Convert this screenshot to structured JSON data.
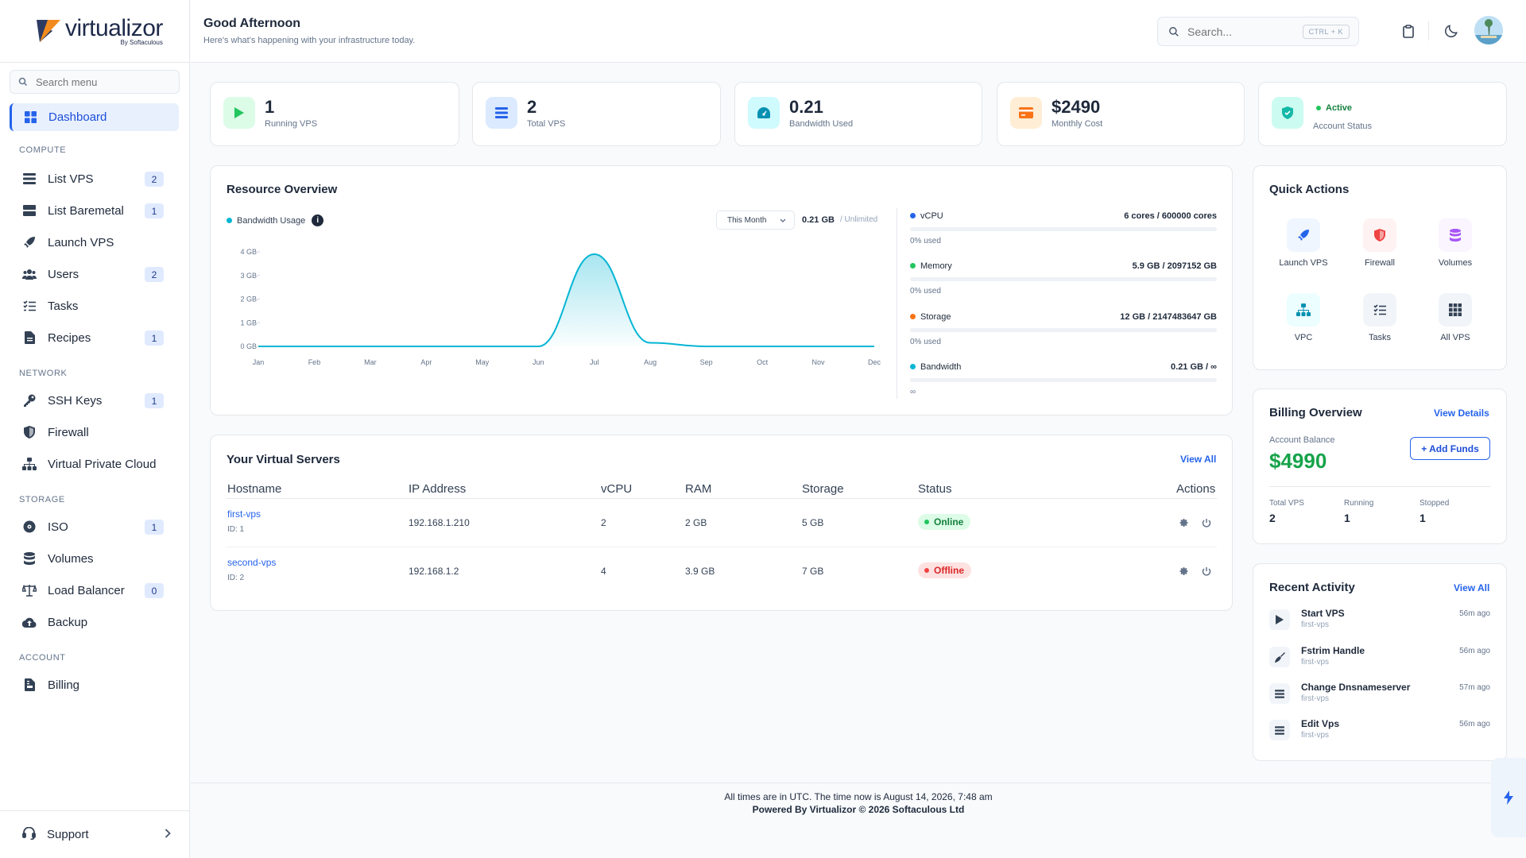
{
  "brand": {
    "name": "virtualizor",
    "sub": "By Softaculous"
  },
  "sidebar": {
    "search_placeholder": "Search menu",
    "dashboard_label": "Dashboard",
    "sections": {
      "compute": "COMPUTE",
      "network": "NETWORK",
      "storage": "STORAGE",
      "account": "ACCOUNT"
    },
    "items": [
      {
        "label": "List VPS",
        "icon": "server-icon",
        "count": "2"
      },
      {
        "label": "List Baremetal",
        "icon": "baremetal-icon",
        "count": "1"
      },
      {
        "label": "Launch VPS",
        "icon": "rocket-icon",
        "count": ""
      },
      {
        "label": "Users",
        "icon": "users-icon",
        "count": "2"
      },
      {
        "label": "Tasks",
        "icon": "tasks-icon",
        "count": ""
      },
      {
        "label": "Recipes",
        "icon": "recipe-icon",
        "count": "1"
      },
      {
        "label": "SSH Keys",
        "icon": "key-icon",
        "count": "1"
      },
      {
        "label": "Firewall",
        "icon": "shield-icon",
        "count": ""
      },
      {
        "label": "Virtual Private Cloud",
        "icon": "network-icon",
        "count": ""
      },
      {
        "label": "ISO",
        "icon": "disc-icon",
        "count": "1"
      },
      {
        "label": "Volumes",
        "icon": "database-icon",
        "count": ""
      },
      {
        "label": "Load Balancer",
        "icon": "balance-icon",
        "count": "0"
      },
      {
        "label": "Backup",
        "icon": "cloud-upload-icon",
        "count": ""
      },
      {
        "label": "Billing",
        "icon": "invoice-icon",
        "count": ""
      }
    ],
    "support_label": "Support"
  },
  "header": {
    "greeting": "Good Afternoon",
    "subtitle": "Here's what's happening with your infrastructure today.",
    "search_placeholder": "Search...",
    "shortcut": "CTRL + K"
  },
  "stats": [
    {
      "value": "1",
      "label": "Running VPS",
      "color": "#22c55e"
    },
    {
      "value": "2",
      "label": "Total VPS",
      "color": "#2563eb"
    },
    {
      "value": "0.21",
      "label": "Bandwidth Used",
      "color": "#0891b2"
    },
    {
      "value": "$2490",
      "label": "Monthly Cost",
      "color": "#f97316"
    },
    {
      "value": "Active",
      "label": "Account Status",
      "color": "#14b8a6"
    }
  ],
  "resource": {
    "title": "Resource Overview",
    "legend": "Bandwidth Usage",
    "period": "This Month",
    "used": "0.21 GB",
    "limit": "/ Unlimited",
    "rows": [
      {
        "name": "vCPU",
        "value": "6 cores / 600000 cores",
        "pct": "0% used",
        "color": "#2563eb"
      },
      {
        "name": "Memory",
        "value": "5.9 GB / 2097152 GB",
        "pct": "0% used",
        "color": "#22c55e"
      },
      {
        "name": "Storage",
        "value": "12 GB / 2147483647 GB",
        "pct": "0% used",
        "color": "#f97316"
      },
      {
        "name": "Bandwidth",
        "value": "0.21 GB / ∞",
        "pct": "∞",
        "color": "#06b6d4"
      }
    ]
  },
  "chart_data": {
    "type": "area",
    "title": "",
    "xlabel": "",
    "ylabel": "",
    "categories": [
      "Jan",
      "Feb",
      "Mar",
      "Apr",
      "May",
      "Jun",
      "Jul",
      "Aug",
      "Sep",
      "Oct",
      "Nov",
      "Dec"
    ],
    "series": [
      {
        "name": "Bandwidth Usage",
        "values": [
          0,
          0,
          0,
          0,
          0,
          0,
          3.9,
          0.15,
          0,
          0,
          0,
          0
        ]
      }
    ],
    "yticks": [
      "0 GB",
      "1 GB",
      "2 GB",
      "3 GB",
      "4 GB"
    ],
    "ylim": [
      0,
      4
    ],
    "color": "#06b6d4",
    "grid": false
  },
  "servers": {
    "title": "Your Virtual Servers",
    "view_all": "View All",
    "columns": [
      "Hostname",
      "IP Address",
      "vCPU",
      "RAM",
      "Storage",
      "Status",
      "Actions"
    ],
    "rows": [
      {
        "host": "first-vps",
        "id": "ID: 1",
        "ip": "192.168.1.210",
        "vcpu": "2",
        "ram": "2 GB",
        "storage": "5 GB",
        "status": "Online"
      },
      {
        "host": "second-vps",
        "id": "ID: 2",
        "ip": "192.168.1.2",
        "vcpu": "4",
        "ram": "3.9 GB",
        "storage": "7 GB",
        "status": "Offline"
      }
    ]
  },
  "quick_actions": {
    "title": "Quick Actions",
    "items": [
      {
        "label": "Launch VPS",
        "icon": "rocket-icon"
      },
      {
        "label": "Firewall",
        "icon": "shield-icon"
      },
      {
        "label": "Volumes",
        "icon": "database-icon"
      },
      {
        "label": "VPC",
        "icon": "network-icon"
      },
      {
        "label": "Tasks",
        "icon": "tasks-icon"
      },
      {
        "label": "All VPS",
        "icon": "grid-icon"
      }
    ]
  },
  "billing": {
    "title": "Billing Overview",
    "view_details": "View Details",
    "balance_label": "Account Balance",
    "balance": "$4990",
    "add_funds": "+ Add Funds",
    "stats": [
      {
        "label": "Total VPS",
        "value": "2"
      },
      {
        "label": "Running",
        "value": "1"
      },
      {
        "label": "Stopped",
        "value": "1"
      }
    ]
  },
  "activity": {
    "title": "Recent Activity",
    "view_all": "View All",
    "items": [
      {
        "name": "Start VPS",
        "sub": "first-vps",
        "time": "56m ago"
      },
      {
        "name": "Fstrim Handle",
        "sub": "first-vps",
        "time": "56m ago"
      },
      {
        "name": "Change Dnsnameserver",
        "sub": "first-vps",
        "time": "57m ago"
      },
      {
        "name": "Edit Vps",
        "sub": "first-vps",
        "time": "56m ago"
      }
    ]
  },
  "footer": {
    "line1": "All times are in UTC. The time now is August 14, 2026, 7:48 am",
    "line2": "Powered By Virtualizor © 2026 Softaculous Ltd"
  }
}
